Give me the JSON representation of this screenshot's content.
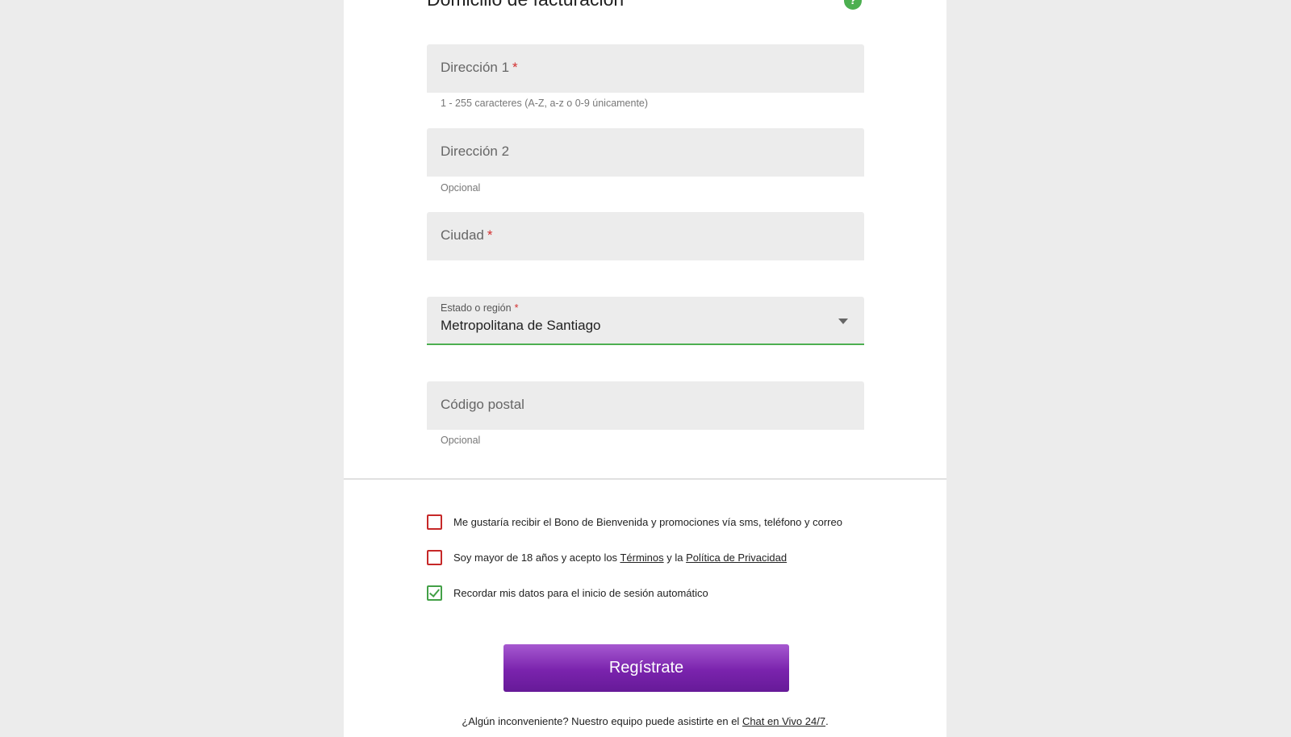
{
  "section": {
    "title": "Domicilio de facturación",
    "help_icon": "question-circle-icon"
  },
  "fields": {
    "address1": {
      "label": "Dirección 1",
      "required_mark": "*",
      "hint": "1 - 255 caracteres (A-Z, a-z o 0-9 únicamente)"
    },
    "address2": {
      "label": "Dirección 2",
      "hint": "Opcional"
    },
    "city": {
      "label": "Ciudad",
      "required_mark": "*"
    },
    "region": {
      "label": "Estado o región",
      "required_mark": "*",
      "value": "Metropolitana de Santiago"
    },
    "postal": {
      "label": "Código postal",
      "hint": "Opcional"
    }
  },
  "checkboxes": {
    "promos": {
      "text": "Me gustaría recibir el Bono de Bienvenida y promociones vía sms, teléfono y correo",
      "checked": false
    },
    "terms": {
      "text_before": "Soy mayor de 18 años y acepto los ",
      "terms_link": "Términos",
      "text_middle": " y la ",
      "privacy_link": "Política de Privacidad",
      "checked": false
    },
    "remember": {
      "text": "Recordar mis datos para el inicio de sesión automático",
      "checked": true
    }
  },
  "register_button": {
    "label": "Regístrate"
  },
  "footer": {
    "text_before": "¿Algún inconveniente? Nuestro equipo puede asistirte en el ",
    "chat_link": "Chat en Vivo 24/7",
    "text_after": "."
  },
  "colors": {
    "accent_green": "#4caf50",
    "error_red": "#c62828",
    "button_purple": "#7a23ad"
  }
}
